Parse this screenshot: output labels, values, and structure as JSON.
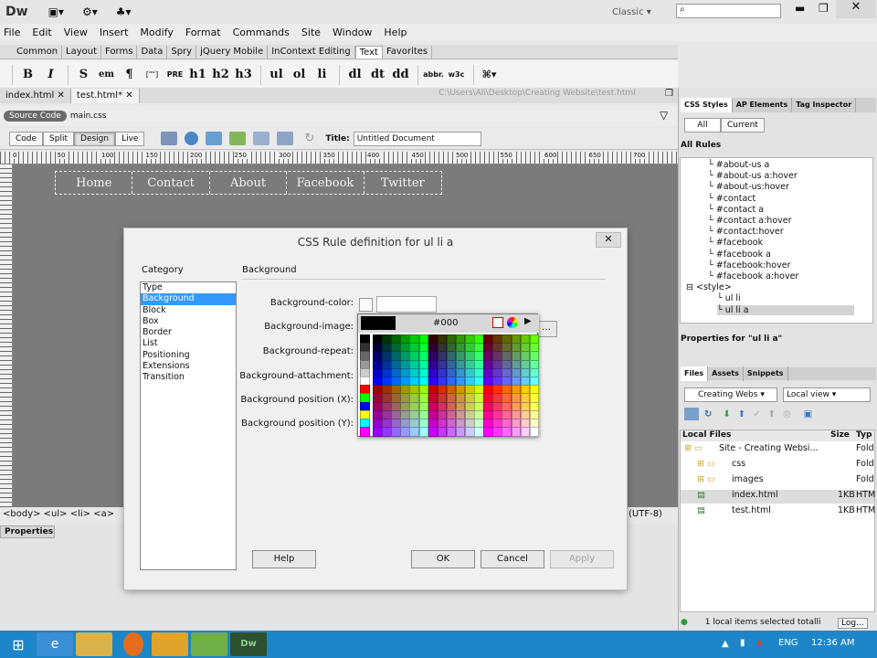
{
  "app": {
    "logo": "Dw",
    "layout": "Classic"
  },
  "menu": [
    "File",
    "Edit",
    "View",
    "Insert",
    "Modify",
    "Format",
    "Commands",
    "Site",
    "Window",
    "Help"
  ],
  "insert_tabs": [
    "Common",
    "Layout",
    "Forms",
    "Data",
    "Spry",
    "jQuery Mobile",
    "InContext Editing",
    "Text",
    "Favorites"
  ],
  "text_buttons": [
    "B",
    "I",
    "S",
    "em",
    "¶",
    "[\"\"]",
    "PRE",
    "h1",
    "h2",
    "h3",
    "ul",
    "ol",
    "li",
    "dl",
    "dt",
    "dd",
    "abbr.",
    "w3c"
  ],
  "doc_tabs": [
    "index.html",
    "test.html*"
  ],
  "doc_path": "C:\\Users\\Ali\\Desktop\\Creating Website\\test.html",
  "source": {
    "label": "Source Code",
    "file": "main.css"
  },
  "view_buttons": [
    "Code",
    "Split",
    "Design",
    "Live"
  ],
  "title_label": "Title:",
  "title_value": "Untitled Document",
  "ruler_numbers": [
    "0",
    "50",
    "100",
    "150",
    "200",
    "250",
    "300",
    "350",
    "400",
    "450",
    "500",
    "550",
    "600",
    "650",
    "700"
  ],
  "nav": [
    "Home",
    "Contact",
    "About",
    "Facebook",
    "Twitter"
  ],
  "tag_path": "<body> <ul> <li> <a>",
  "encoding": "(UTF-8)",
  "properties_label": "Properties",
  "dialog": {
    "title": "CSS Rule definition for ul li a",
    "category_label": "Category",
    "section_label": "Background",
    "categories": [
      "Type",
      "Background",
      "Block",
      "Box",
      "Border",
      "List",
      "Positioning",
      "Extensions",
      "Transition"
    ],
    "fields": [
      "Background-color:",
      "Background-image:",
      "Background-repeat:",
      "Background-attachment:",
      "Background position (X):",
      "Background position (Y):"
    ],
    "buttons": {
      "help": "Help",
      "ok": "OK",
      "cancel": "Cancel",
      "apply": "Apply"
    }
  },
  "palette": {
    "hex": "#000"
  },
  "css_panel": {
    "tabs": [
      "CSS Styles",
      "AP Elements",
      "Tag Inspector"
    ],
    "modes": [
      "All",
      "Current"
    ],
    "all_rules": "All Rules",
    "rules": [
      "#about-us a",
      "#about-us a:hover",
      "#about-us:hover",
      "#contact",
      "#contact a",
      "#contact a:hover",
      "#contact:hover",
      "#facebook",
      "#facebook a",
      "#facebook:hover",
      "#facebook a:hover",
      "<style>",
      "ul li",
      "ul li a"
    ],
    "props_label": "Properties for \"ul li a\""
  },
  "files_panel": {
    "tabs": [
      "Files",
      "Assets",
      "Snippets"
    ],
    "site_select": "Creating Webs",
    "view_select": "Local view",
    "headers": [
      "Local Files",
      "Size",
      "Typ"
    ],
    "rows": [
      {
        "name": "Site - Creating Websi...",
        "size": "",
        "type": "Fold"
      },
      {
        "name": "css",
        "size": "",
        "type": "Fold"
      },
      {
        "name": "images",
        "size": "",
        "type": "Fold"
      },
      {
        "name": "index.html",
        "size": "1KB",
        "type": "HTM"
      },
      {
        "name": "test.html",
        "size": "1KB",
        "type": "HTM"
      }
    ],
    "status": "1 local items selected totalli",
    "log": "Log..."
  },
  "taskbar": {
    "lang": "ENG",
    "time": "12:36 AM"
  }
}
